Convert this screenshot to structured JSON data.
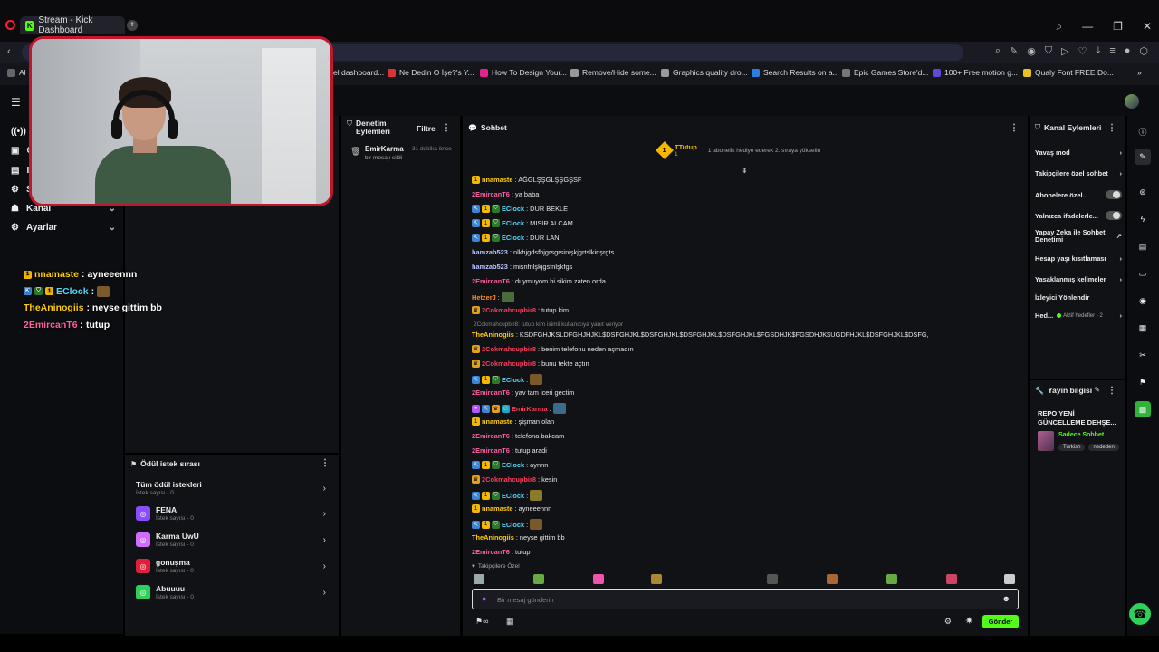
{
  "browser": {
    "tab_title": "Stream - Kick Dashboard",
    "bookmarks": [
      "Al",
      "el dashboard...",
      "Ne Dedin O İşe?'s Y...",
      "How To Design Your...",
      "Remove/Hide some...",
      "Graphics quality dro...",
      "Search Results on a...",
      "Epic Games Store'd...",
      "100+ Free motion g...",
      "Qualy Font FREE Do..."
    ]
  },
  "left_menu": {
    "items": [
      {
        "label": "Kanal",
        "icon": "channel-icon"
      },
      {
        "label": "Ayarlar",
        "icon": "gear-icon"
      }
    ],
    "partial_letters": [
      "V",
      "C",
      "I",
      "S"
    ]
  },
  "overlay_chat": [
    {
      "user": "nnamaste",
      "color": "#ffcd05",
      "text": ": ayneeennn"
    },
    {
      "user": "EClock",
      "color": "#53d8fb",
      "text": ":"
    },
    {
      "user": "TheAninogiis",
      "color": "#ffcd05",
      "text": ": neyse gittim bb"
    },
    {
      "user": "2EmircanT6",
      "color": "#ff5fa2",
      "text": ": tutup"
    }
  ],
  "mod_panel": {
    "title": "Denetim Eylemleri",
    "filter_label": "Filtre",
    "entry": {
      "user": "EmirKarma",
      "time": "31 dakika önce",
      "action": "bir mesajı sildi"
    }
  },
  "queue_panel": {
    "title": "Ödül istek sırası",
    "all_title": "Tüm ödül istekleri",
    "all_sub": "İstek sayısı - 0",
    "items": [
      {
        "name": "FENA",
        "sub": "İstek sayısı - 0",
        "color": "#8a4dff"
      },
      {
        "name": "Karma UwU",
        "sub": "İstek sayısı - 0",
        "color": "#d06cff"
      },
      {
        "name": "gonuşma",
        "sub": "İstek sayısı - 0",
        "color": "#e0203a"
      },
      {
        "name": "Abuuuu",
        "sub": "İstek sayısı - 0",
        "color": "#2fd05a"
      }
    ]
  },
  "chat": {
    "title": "Sohbet",
    "top_user": "TTutup",
    "top_user_count": "1",
    "top_badge": "1",
    "pinned_note": "1 abonelik hediye ederek 2. sıraya yükselin",
    "messages": [
      {
        "user": "nnamaste",
        "color": "#ffcd05",
        "text": ": AĞGLŞŞGLŞŞGŞSF",
        "badges": [
          "sub"
        ]
      },
      {
        "user": "2EmircanT6",
        "color": "#ff5fa2",
        "text": ": ya baba",
        "badges": []
      },
      {
        "user": "EClock",
        "color": "#53d8fb",
        "text": ": DUR BEKLE",
        "badges": [
          "vip",
          "sub",
          "mod"
        ]
      },
      {
        "user": "EClock",
        "color": "#53d8fb",
        "text": ": MISIR ALCAM",
        "badges": [
          "vip",
          "sub",
          "mod"
        ]
      },
      {
        "user": "EClock",
        "color": "#53d8fb",
        "text": ": DUR LAN",
        "badges": [
          "vip",
          "sub",
          "mod"
        ]
      },
      {
        "user": "hamzab523",
        "color": "#b8c4ff",
        "text": ": nlkhjgdsfhjgrsgrsinişkjgrtslkinşrgts",
        "badges": []
      },
      {
        "user": "hamzab523",
        "color": "#b8c4ff",
        "text": ": mişnfnlşkjgsfnlşkfgs",
        "badges": []
      },
      {
        "user": "2EmircanT6",
        "color": "#ff5fa2",
        "text": ": duymuyom bi sikim zaten orda",
        "badges": []
      },
      {
        "user": "HetzerJ",
        "color": "#ff8a1c",
        "text": ":",
        "badges": [],
        "emote": "#4a6b3a"
      },
      {
        "user": "2Cokmahcupbir8",
        "color": "#ff3b5c",
        "text": ": tutup kim",
        "badges": [
          "crown"
        ]
      },
      {
        "reply": "2Cokmahcupbir8: tutup kim isimli kullanıcıya yanıt veriyor"
      },
      {
        "user": "TheAninogiis",
        "color": "#ffcd05",
        "text": ": KSDFGHJKSLDFGHJHJKL$DSFGHJKL$DSFGHJKL$DSFGHJKL$DSFGHJKL$FGSDHJK$FGSDHJK$UGDFHJKL$DSFGHJKL$DSFG,",
        "badges": []
      },
      {
        "user": "2Cokmahcupbir8",
        "color": "#ff3b5c",
        "text": ": benim telefonu neden açmadın",
        "badges": [
          "crown"
        ]
      },
      {
        "user": "2Cokmahcupbir8",
        "color": "#ff3b5c",
        "text": ": bunu tekte açtın",
        "badges": [
          "crown"
        ]
      },
      {
        "user": "EClock",
        "color": "#53d8fb",
        "text": ":",
        "badges": [
          "vip",
          "sub",
          "mod"
        ],
        "emote": "#7a5a2a"
      },
      {
        "user": "2EmircanT6",
        "color": "#ff5fa2",
        "text": ": yav tam iceri gectim",
        "badges": []
      },
      {
        "user": "EmirKarma",
        "color": "#ff3b5c",
        "text": ":",
        "badges": [
          "mic",
          "vip",
          "crown",
          "link"
        ],
        "emote": "#3a6b8a"
      },
      {
        "user": "nnamaste",
        "color": "#ffcd05",
        "text": ": şişman olan",
        "badges": [
          "sub"
        ]
      },
      {
        "user": "2EmircanT6",
        "color": "#ff5fa2",
        "text": ": telefona bakcam",
        "badges": []
      },
      {
        "user": "2EmircanT6",
        "color": "#ff5fa2",
        "text": ": tutup aradi",
        "badges": []
      },
      {
        "user": "EClock",
        "color": "#53d8fb",
        "text": ": aynnn",
        "badges": [
          "vip",
          "sub",
          "mod"
        ]
      },
      {
        "user": "2Cokmahcupbir8",
        "color": "#ff3b5c",
        "text": ": kesin",
        "badges": [
          "crown"
        ]
      },
      {
        "user": "EClock",
        "color": "#53d8fb",
        "text": ":",
        "badges": [
          "vip",
          "sub",
          "mod"
        ],
        "emote": "#8a7a2a"
      },
      {
        "user": "nnamaste",
        "color": "#ffcd05",
        "text": ": ayneeennn",
        "badges": [
          "sub"
        ]
      },
      {
        "user": "EClock",
        "color": "#53d8fb",
        "text": ":",
        "badges": [
          "vip",
          "sub",
          "mod"
        ],
        "emote": "#7a5a2a"
      },
      {
        "user": "TheAninogiis",
        "color": "#ffcd05",
        "text": ": neyse gittim bb",
        "badges": []
      },
      {
        "user": "2EmircanT6",
        "color": "#ff5fa2",
        "text": ": tutup",
        "badges": []
      }
    ],
    "emote_section": "Takipçilere Özel",
    "input_placeholder": "Bir mesaj gönderin",
    "send_label": "Gönder"
  },
  "actions_panel": {
    "title": "Kanal Eylemleri",
    "items": [
      {
        "label": "Yavaş mod",
        "control": "chevron"
      },
      {
        "label": "Takipçilere özel sohbet",
        "control": "chevron"
      },
      {
        "label": "Abonelere özel...",
        "control": "toggle"
      },
      {
        "label": "Yalnızca ifadelerle...",
        "control": "toggle"
      },
      {
        "label": "Yapay Zeka ile Sohbet Denetimi",
        "control": "external"
      },
      {
        "label": "Hesap yaşı kısıtlaması",
        "control": "chevron"
      },
      {
        "label": "Yasaklanmış kelimeler",
        "control": "chevron"
      },
      {
        "label": "İzleyici Yönlendir",
        "control": "none"
      }
    ],
    "goals_label": "Hed...",
    "goals_status": "Aktif hedefler - 2"
  },
  "info_panel": {
    "title": "Yayın bilgisi",
    "stream_title": "REPO YENİ GÜNCELLEME DEHŞE...",
    "category": "Sadece Sohbet",
    "tags": [
      "Turkish",
      "nededen"
    ]
  },
  "colors": {
    "accent": "#53fc18",
    "panel": "#111216",
    "bg": "#000000"
  }
}
